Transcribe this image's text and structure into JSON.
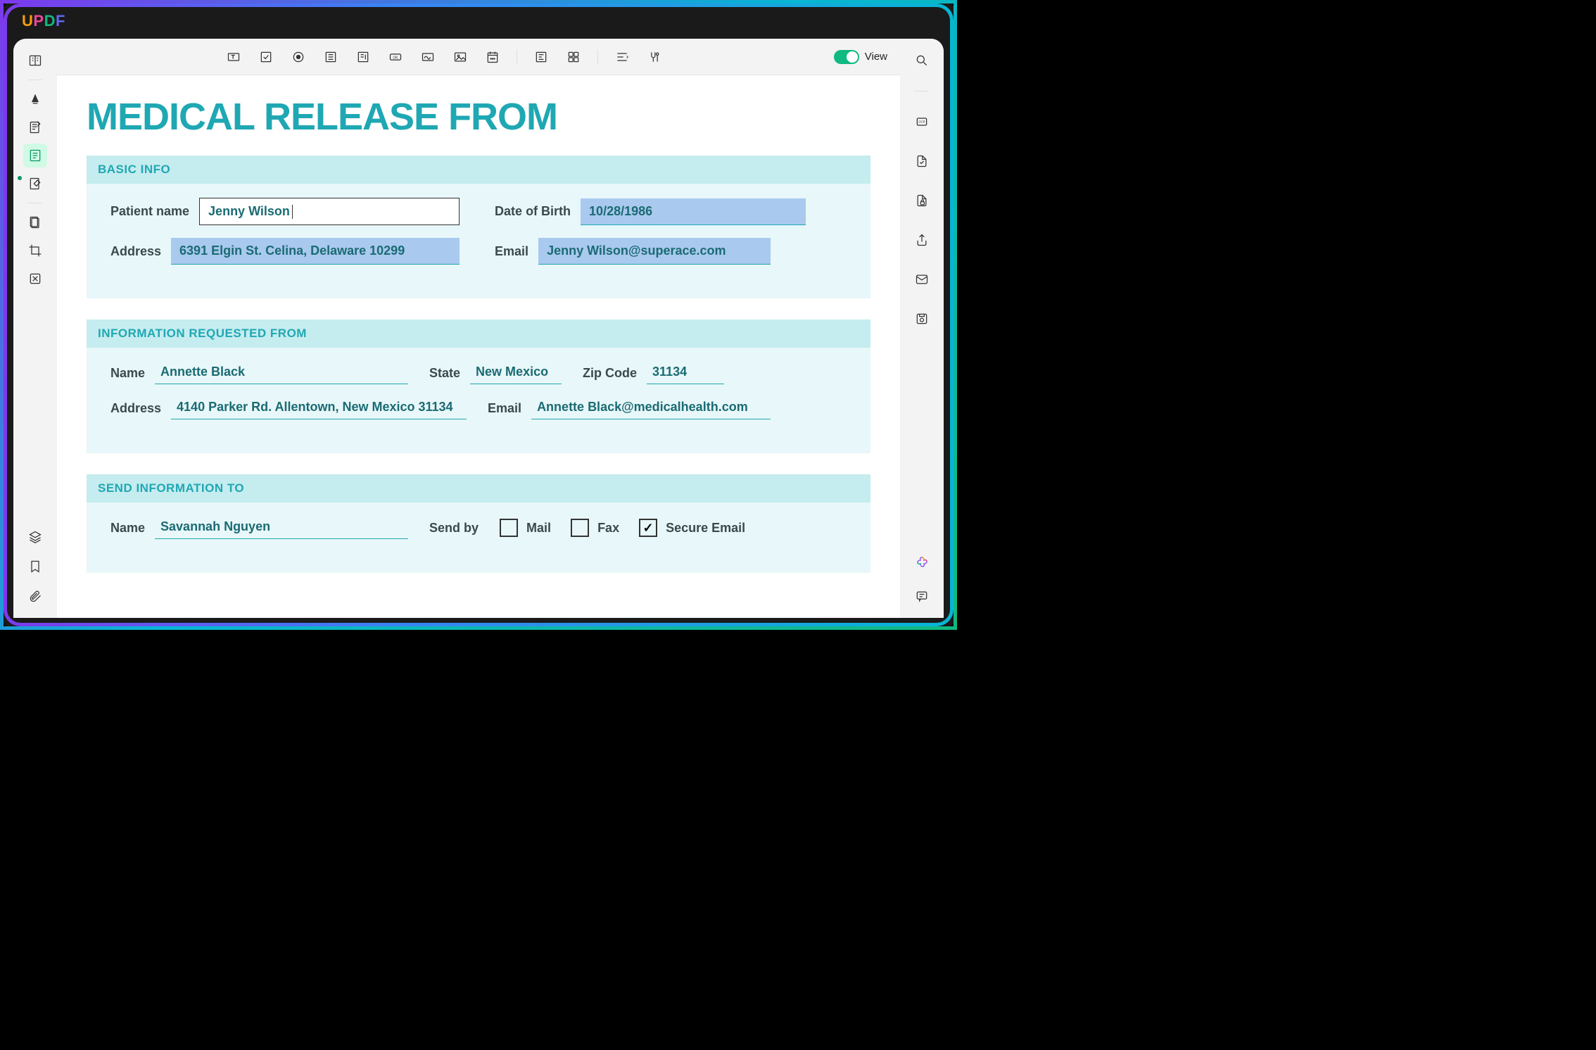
{
  "app": {
    "name": "UPDF"
  },
  "toolbar": {
    "view_label": "View"
  },
  "doc": {
    "title": "MEDICAL RELEASE FROM",
    "sections": {
      "basic": {
        "header": "BASIC INFO",
        "patient_name_label": "Patient name",
        "patient_name": "Jenny Wilson",
        "dob_label": "Date of Birth",
        "dob": "10/28/1986",
        "address_label": "Address",
        "address": "6391 Elgin St. Celina, Delaware 10299",
        "email_label": "Email",
        "email": "Jenny Wilson@superace.com"
      },
      "requested": {
        "header": "INFORMATION REQUESTED FROM",
        "name_label": "Name",
        "name": "Annette Black",
        "state_label": "State",
        "state": "New Mexico",
        "zip_label": "Zip Code",
        "zip": "31134",
        "address_label": "Address",
        "address": "4140 Parker Rd. Allentown, New Mexico 31134",
        "email_label": "Email",
        "email": "Annette Black@medicalhealth.com"
      },
      "sendto": {
        "header": "SEND INFORMATION TO",
        "name_label": "Name",
        "name": "Savannah Nguyen",
        "sendby_label": "Send by",
        "opt_mail": "Mail",
        "opt_fax": "Fax",
        "opt_secure": "Secure Email",
        "mail_checked": false,
        "fax_checked": false,
        "secure_checked": true
      }
    }
  }
}
